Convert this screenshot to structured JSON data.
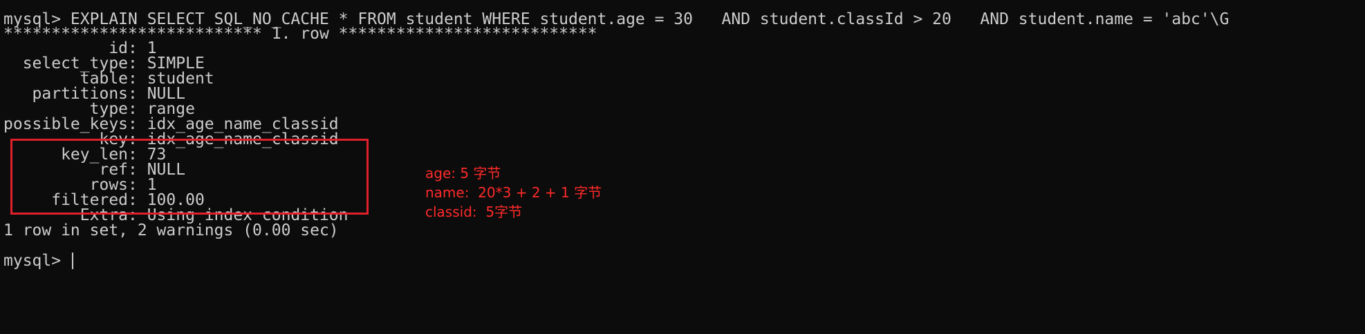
{
  "terminal": {
    "command": "mysql> EXPLAIN SELECT SQL_NO_CACHE * FROM student WHERE student.age = 30   AND student.classId > 20   AND student.name = 'abc'\\G",
    "row_header": "*************************** 1. row ***************************",
    "fields": [
      {
        "line": "           id: 1"
      },
      {
        "line": "  select_type: SIMPLE"
      },
      {
        "line": "        table: student"
      },
      {
        "line": "   partitions: NULL"
      },
      {
        "line": "         type: range"
      },
      {
        "line": "possible_keys: idx_age_name_classid"
      },
      {
        "line": "          key: idx_age_name_classid"
      },
      {
        "line": "      key_len: 73"
      },
      {
        "line": "          ref: NULL"
      },
      {
        "line": "         rows: 1"
      },
      {
        "line": "     filtered: 100.00"
      },
      {
        "line": "        Extra: Using index condition"
      }
    ],
    "summary": "1 row in set, 2 warnings (0.00 sec)",
    "prompt": "mysql> "
  },
  "annotation": {
    "lines": [
      "age: 5 字节",
      "name:  20*3 + 2 + 1 字节",
      "classid:  5字节"
    ],
    "color": "#ff2a2a"
  },
  "colors": {
    "background": "#0c0c0c",
    "text": "#cccccc",
    "highlight_border": "#e0202a"
  }
}
